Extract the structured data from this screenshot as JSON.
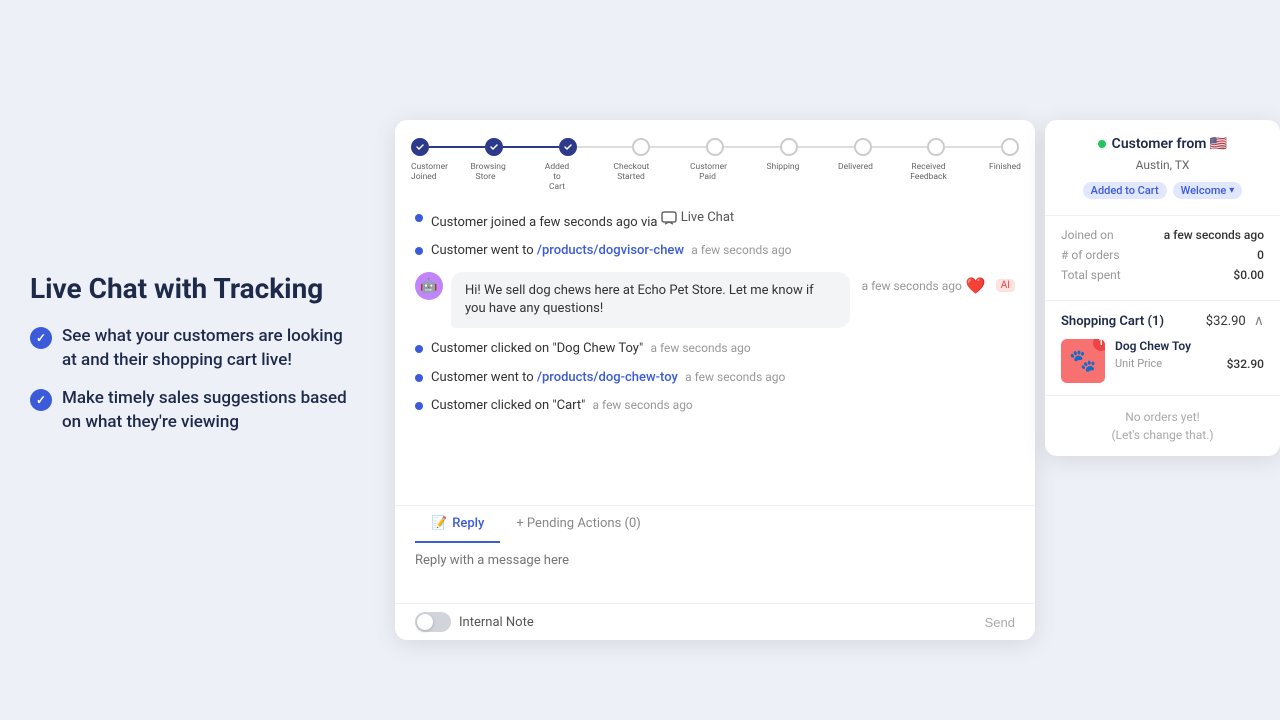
{
  "left": {
    "title": "Live Chat with Tracking",
    "features": [
      "See what your customers are looking at and their shopping cart live!",
      "Make timely sales suggestions based on what they're viewing"
    ]
  },
  "progress": {
    "steps": [
      {
        "label": "Customer\nJoined",
        "state": "done"
      },
      {
        "label": "Browsing\nStore",
        "state": "done"
      },
      {
        "label": "Added to\nCart",
        "state": "done"
      },
      {
        "label": "Checkout\nStarted",
        "state": "empty"
      },
      {
        "label": "Customer\nPaid",
        "state": "empty"
      },
      {
        "label": "Shipping",
        "state": "empty"
      },
      {
        "label": "Delivered",
        "state": "empty"
      },
      {
        "label": "Received\nFeedback",
        "state": "empty"
      },
      {
        "label": "Finished",
        "state": "empty"
      }
    ]
  },
  "chat": {
    "events": [
      {
        "type": "event",
        "text": "Customer joined a few seconds ago via",
        "extra": "Live Chat",
        "time": ""
      },
      {
        "type": "event",
        "text": "Customer went to",
        "link": "/products/dogvisor-chew",
        "time": "a few seconds ago"
      },
      {
        "type": "bot",
        "text": "Hi! We sell dog chews here at Echo Pet Store. Let me know if you have any questions!",
        "time": "a few seconds ago",
        "ai": "AI"
      },
      {
        "type": "event",
        "text": "Customer clicked on \"Dog Chew Toy\"",
        "time": "a few seconds ago"
      },
      {
        "type": "event",
        "text": "Customer went to",
        "link": "/products/dog-chew-toy",
        "time": "a few seconds ago"
      },
      {
        "type": "event",
        "text": "Customer clicked on \"Cart\"",
        "time": "a few seconds ago"
      }
    ],
    "reply_placeholder": "Reply with a message here",
    "tabs": [
      {
        "id": "reply",
        "label": "Reply",
        "icon": "📝",
        "active": true
      },
      {
        "id": "pending",
        "label": "+ Pending Actions (0)",
        "icon": "",
        "active": false
      }
    ],
    "toggle_label": "Internal Note",
    "send_label": "Send"
  },
  "customer": {
    "name": "Customer from",
    "flag": "🇺🇸",
    "location": "Austin, TX",
    "online": true,
    "badges": [
      "Added to Cart",
      "Welcome"
    ],
    "joined_label": "Joined on",
    "joined_value": "a few seconds ago",
    "orders_label": "# of orders",
    "orders_value": "0",
    "spent_label": "Total spent",
    "spent_value": "$0.00",
    "cart": {
      "title": "Shopping Cart (1)",
      "total": "$32.90",
      "item": {
        "name": "Dog Chew Toy",
        "qty": 1,
        "unit_price_label": "Unit Price",
        "unit_price": "$32.90"
      }
    },
    "orders_empty_line1": "No orders yet!",
    "orders_empty_line2": "(Let's change that.)"
  }
}
